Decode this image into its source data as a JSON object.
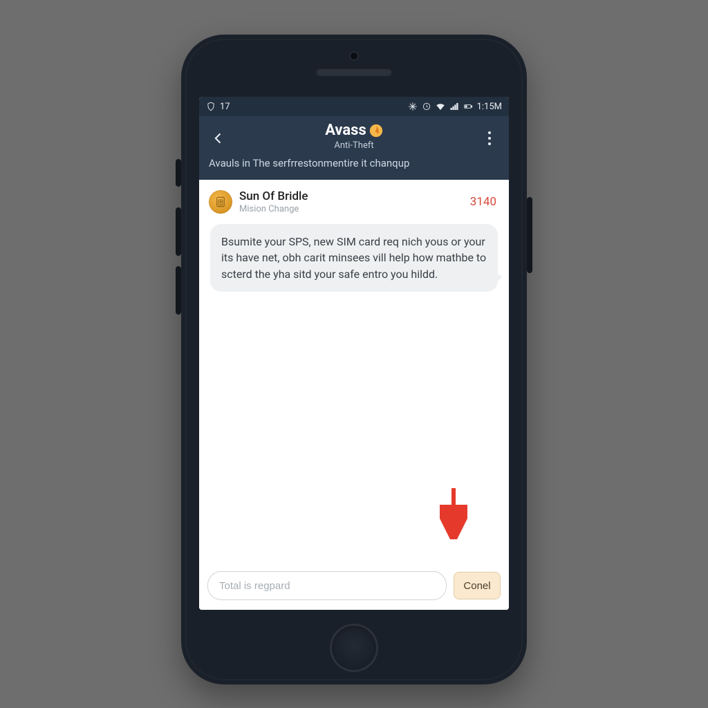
{
  "statusbar": {
    "notif_count": "17",
    "clock": "1:15M"
  },
  "appbar": {
    "brand": "Avass",
    "subtitle": "Anti-Theft",
    "description": "Avauls in The serfrrestonmentire it chanqup"
  },
  "thread": {
    "sender_name": "Sun Of Bridle",
    "sender_sub": "Mision Change",
    "meta_number": "3140",
    "message": "Bsumite your SPS, new SIM card req nich yous or your its have net, obh carit minsees vill help how mathbe to scterd the yha sitd your safe entro you hildd."
  },
  "composer": {
    "placeholder": "Total is regpard",
    "send_label": "Conel"
  },
  "colors": {
    "accent": "#f4b74a",
    "header": "#2b3a4d",
    "warn": "#d64a3a"
  }
}
